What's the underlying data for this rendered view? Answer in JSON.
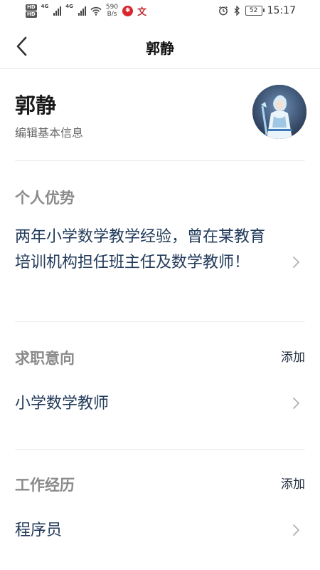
{
  "status_bar": {
    "hd1": "HD",
    "hd2": "HD",
    "net1": "4G",
    "net2": "4G",
    "speed_value": "590",
    "speed_unit": "B/s",
    "battery": "52",
    "time": "15:17"
  },
  "nav": {
    "title": "郭静"
  },
  "profile": {
    "name": "郭静",
    "edit_label": "编辑基本信息"
  },
  "sections": {
    "advantage": {
      "title": "个人优势",
      "text": "两年小学数学教学经验，曾在某教育培训机构担任班主任及数学教师！"
    },
    "intention": {
      "title": "求职意向",
      "add_label": "添加",
      "item": "小学数学教师"
    },
    "experience": {
      "title": "工作经历",
      "add_label": "添加",
      "item": "程序员"
    }
  }
}
